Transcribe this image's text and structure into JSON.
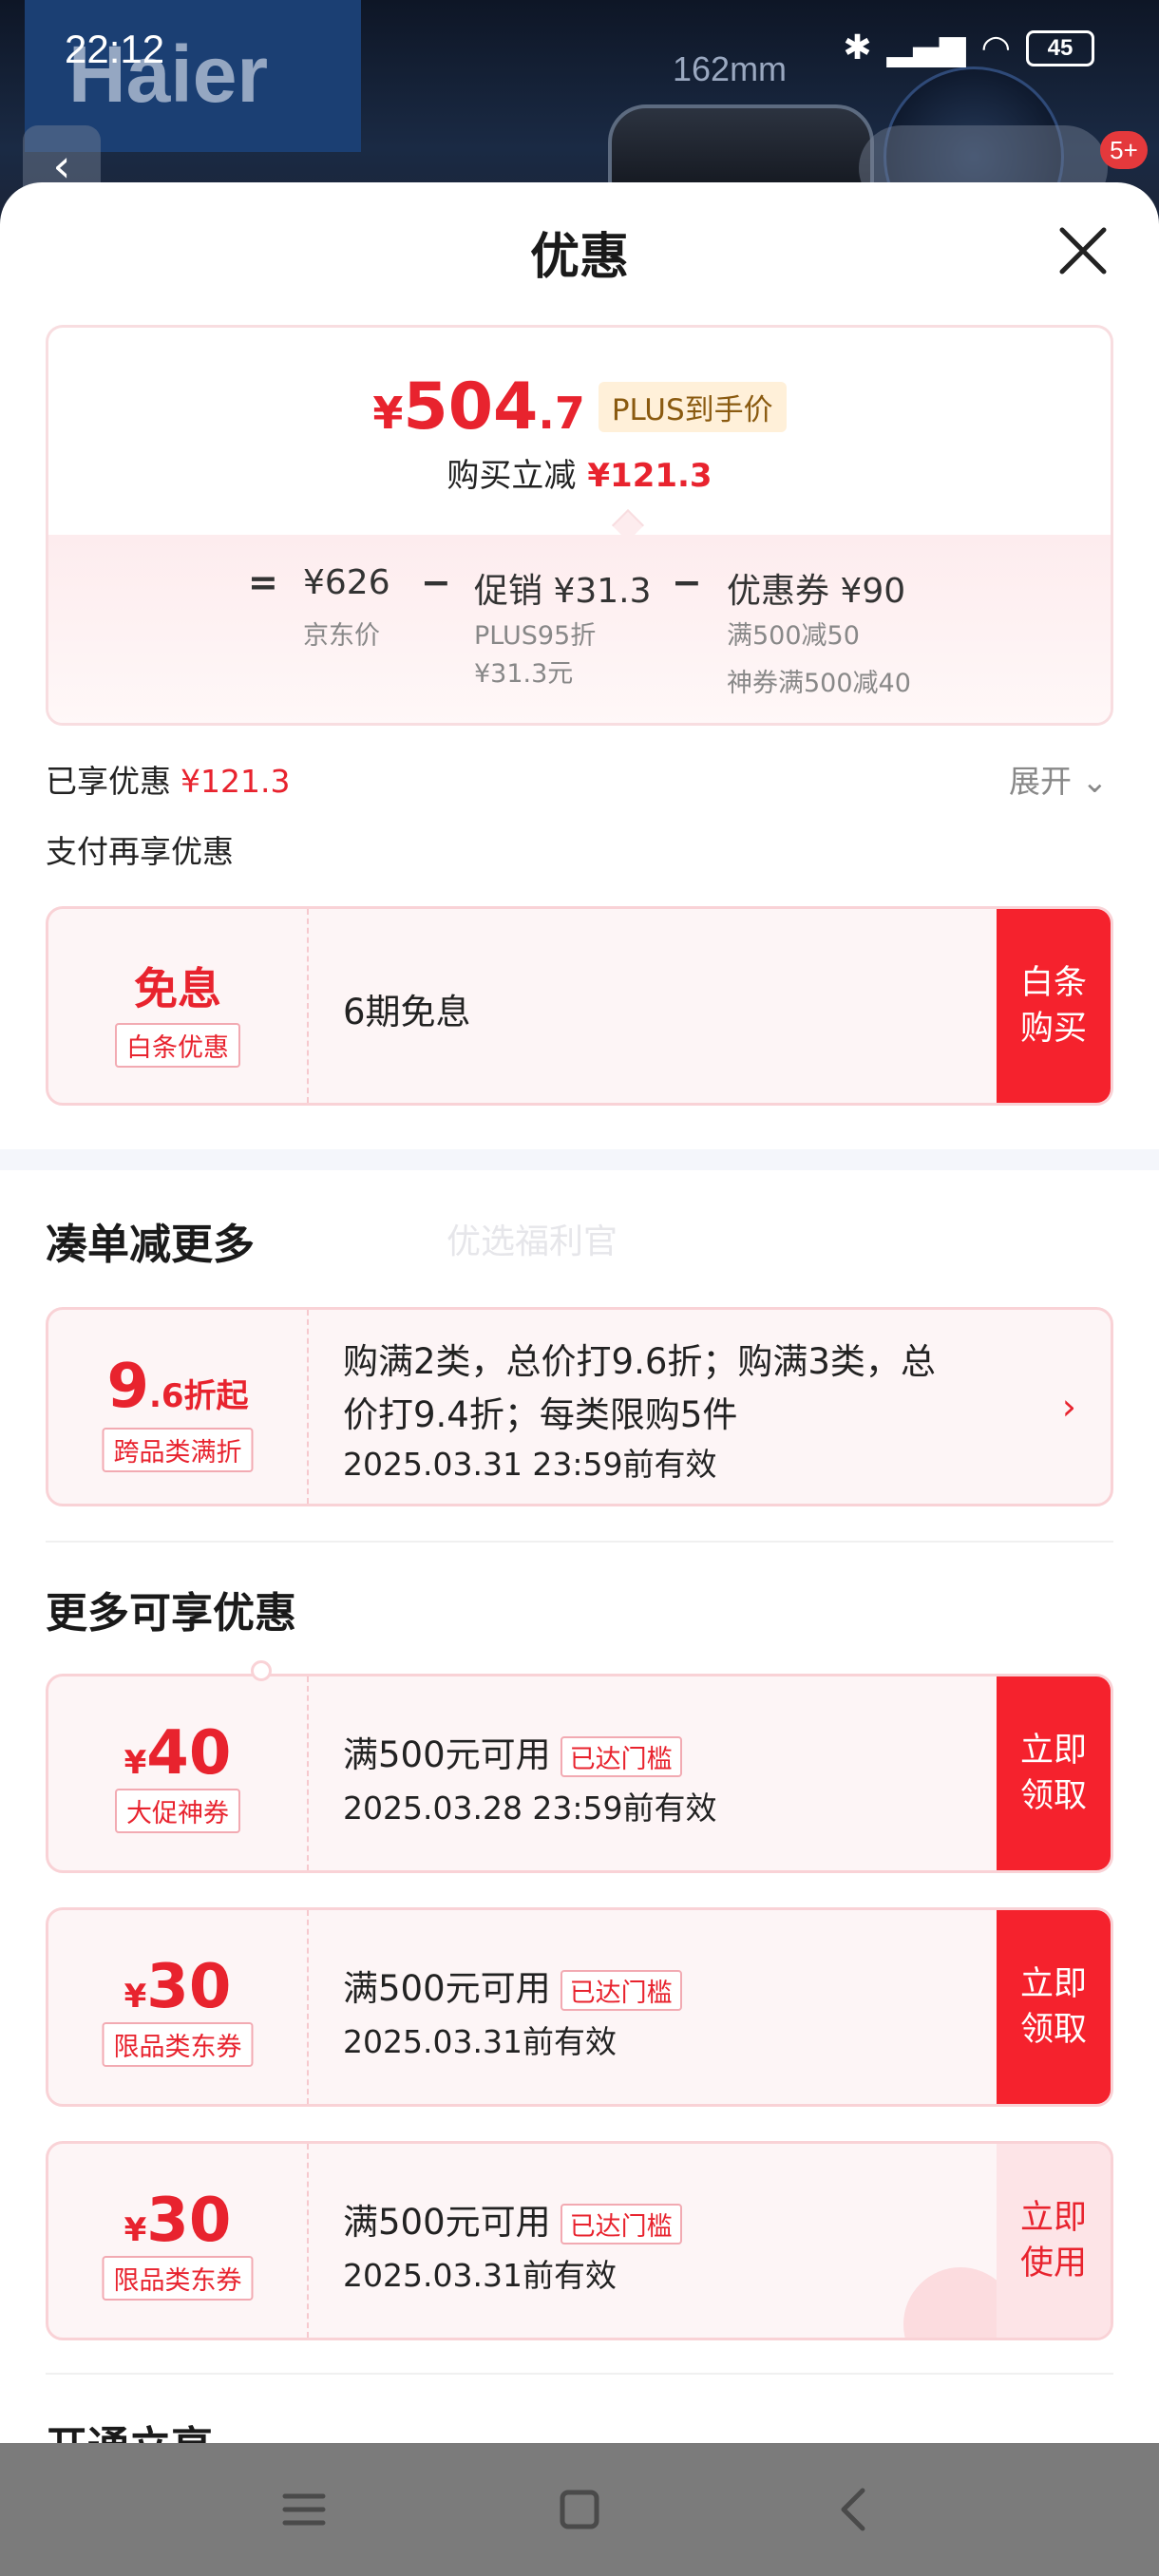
{
  "status_bar": {
    "time": "22:12",
    "battery": "45"
  },
  "background": {
    "brand_logo": "Haier",
    "dimension_label": "162mm",
    "cart_badge": "5+"
  },
  "sheet": {
    "title": "优惠"
  },
  "price": {
    "currency": "¥",
    "amount_int": "504",
    "amount_dec": ".7",
    "plus_tag": "PLUS到手价",
    "instant_cut_label": "购买立减",
    "instant_cut_value": "¥121.3"
  },
  "breakdown": {
    "equals": "=",
    "minus": "−",
    "jd_price": "¥626",
    "jd_price_label": "京东价",
    "promo": "促销 ¥31.3",
    "promo_note1": "PLUS95折",
    "promo_note2": "¥31.3元",
    "coupon": "优惠券 ¥90",
    "coupon_note1": "满500减50",
    "coupon_note2": "神券满500减40"
  },
  "enjoyed": {
    "label": "已享优惠",
    "value": "¥121.3",
    "expand_label": "展开"
  },
  "pay_more_label": "支付再享优惠",
  "installment": {
    "big": "免息",
    "tag": "白条优惠",
    "text": "6期免息",
    "button": "白条购买"
  },
  "bundle": {
    "section_title": "凑单减更多",
    "watermark": "优选福利官",
    "big_int": "9",
    "big_dec": ".6",
    "big_suffix": "折起",
    "tag": "跨品类满折",
    "line1": "购满2类，总价打9.6折；购满3类，总",
    "line2": "价打9.4折；每类限购5件",
    "line3": "2025.03.31 23:59前有效"
  },
  "more": {
    "section_title": "更多可享优惠",
    "coupons": [
      {
        "amount": "40",
        "tag": "大促神券",
        "condition": "满500元可用",
        "reached": "已达门槛",
        "expiry": "2025.03.28 23:59前有效",
        "button": "立即领取",
        "light": false
      },
      {
        "amount": "30",
        "tag": "限品类东券",
        "condition": "满500元可用",
        "reached": "已达门槛",
        "expiry": "2025.03.31前有效",
        "button": "立即领取",
        "light": false
      },
      {
        "amount": "30",
        "tag": "限品类东券",
        "condition": "满500元可用",
        "reached": "已达门槛",
        "expiry": "2025.03.31前有效",
        "button": "立即使用",
        "light": true
      }
    ],
    "next_section_partial": "开通立享"
  }
}
